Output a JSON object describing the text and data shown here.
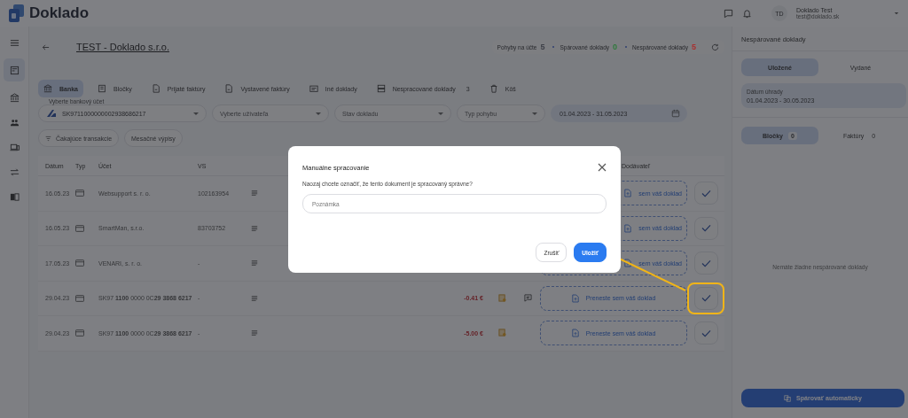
{
  "app": {
    "name": "Doklado"
  },
  "user": {
    "initials": "TD",
    "name": "Doklado Test",
    "email": "test@doklado.sk"
  },
  "sidebar": {
    "items": [
      {
        "selected": false
      },
      {
        "selected": true
      },
      {
        "selected": false
      },
      {
        "selected": false
      },
      {
        "selected": false
      },
      {
        "selected": false
      },
      {
        "selected": false
      }
    ]
  },
  "page": {
    "title": "TEST - Doklado s.r.o."
  },
  "stats": [
    {
      "label": "Pohyby na účte",
      "value": "5",
      "color": "#3e4048"
    },
    {
      "label": "Spárované doklady",
      "value": "0",
      "color": "#2f7a3c"
    },
    {
      "label": "Nespárované doklady",
      "value": "5",
      "color": "#a8302f"
    }
  ],
  "tabs": [
    {
      "label": "Banka",
      "selected": true
    },
    {
      "label": "Bločky",
      "selected": false
    },
    {
      "label": "Prijaté faktúry",
      "selected": false
    },
    {
      "label": "Vystavené faktúry",
      "selected": false
    },
    {
      "label": "Iné doklady",
      "selected": false
    },
    {
      "label": "Nespracované doklady",
      "count": "3",
      "selected": false
    },
    {
      "label": "Kôš",
      "selected": false
    }
  ],
  "filters": {
    "account": {
      "label": "Vyberte bankový účet",
      "value": "SK9711000000002938686217"
    },
    "user": {
      "placeholder": "Vyberte užívateľa"
    },
    "status": {
      "placeholder": "Stav dokladu"
    },
    "movement": {
      "placeholder": "Typ pohybu"
    },
    "date_range": {
      "value": "01.04.2023 - 31.05.2023"
    }
  },
  "chips": [
    "Čakajúce transakcie",
    "Mesačné výpisy"
  ],
  "table": {
    "columns": [
      "Dátum",
      "Typ",
      "Účet",
      "VS",
      "Dodávateľ"
    ],
    "rows": [
      {
        "date": "16.05.23",
        "account": "Websupport s. r. o.",
        "vs": "102163954",
        "dropzone": "sem váš doklad",
        "highlighted": false
      },
      {
        "date": "16.05.23",
        "account": "SmartMan, s.r.o.",
        "vs": "83703752",
        "dropzone": "sem váš doklad",
        "highlighted": false
      },
      {
        "date": "17.05.23",
        "account": "VENARI, s. r. o.",
        "vs": "-",
        "dropzone": "sem váš doklad",
        "highlighted": false
      },
      {
        "date": "29.04.23",
        "account": "SK97 **1100** 0000 0C**29 3868 6217**",
        "vs": "-",
        "amount": "-0.41 €",
        "dropzone": "Preneste sem váš doklad",
        "receipt_icon": true,
        "comment_icon": true,
        "highlighted": true
      },
      {
        "date": "29.04.23",
        "account": "SK97 **1100** 0000 0C**29 3868 6217**",
        "vs": "-",
        "amount": "-5.00 €",
        "dropzone": "Preneste sem váš doklad",
        "receipt_icon": true,
        "comment_icon": false,
        "highlighted": false
      }
    ]
  },
  "right_panel": {
    "title": "Nespárované doklady",
    "toggle": [
      {
        "label": "Uložené",
        "selected": true
      },
      {
        "label": "Vydané",
        "selected": false
      }
    ],
    "date_field": {
      "label": "Dátum úhrady",
      "value": "01.04.2023 - 30.05.2023"
    },
    "tabs": [
      {
        "label": "Bločky",
        "count": "0",
        "selected": true
      },
      {
        "label": "Faktúry",
        "count": "0",
        "selected": false
      }
    ],
    "empty_text": "Nemáte žiadne nespárované doklady",
    "button": "Spárovať automaticky"
  },
  "modal": {
    "title": "Manuálne spracovanie",
    "message": "Naozaj chcete označiť, že tento dokument je spracovaný správne?",
    "note": {
      "placeholder": "Poznámka"
    },
    "buttons": [
      {
        "label": "Zrušiť",
        "kind": "secondary"
      },
      {
        "label": "Uložiť",
        "kind": "primary"
      }
    ]
  }
}
